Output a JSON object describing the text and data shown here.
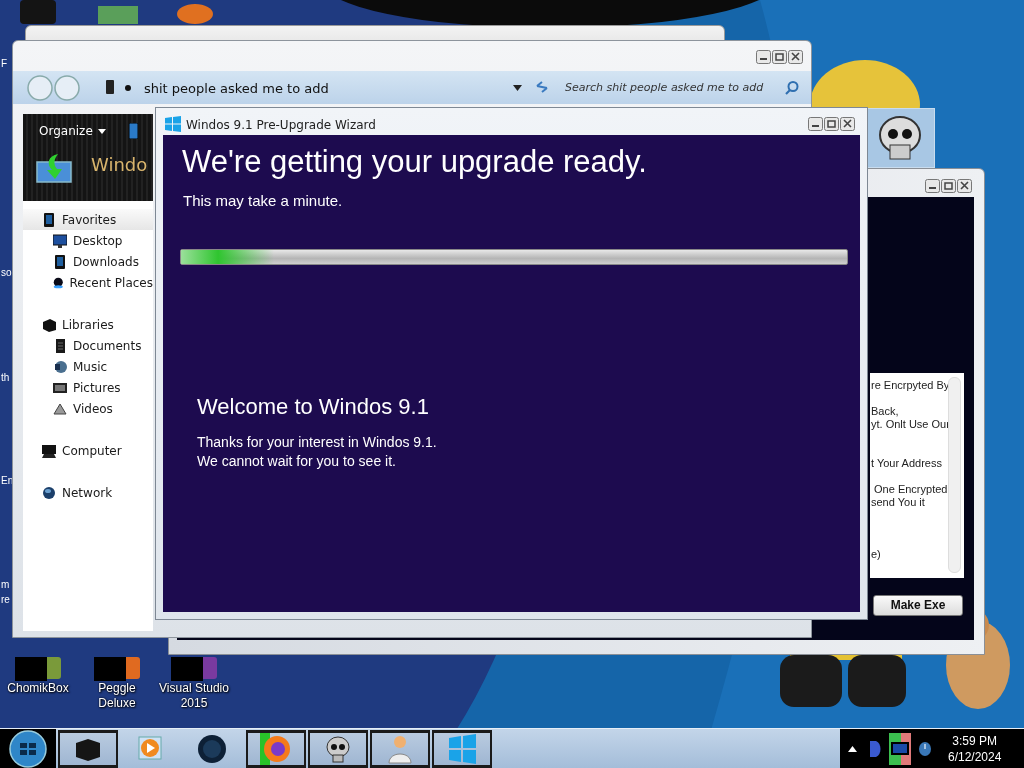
{
  "desktop": {
    "edge_labels": [
      "F",
      "so",
      "th",
      "En",
      "m",
      "re"
    ],
    "icons": [
      {
        "label": "ChomikBox"
      },
      {
        "label": "Peggle Deluxe"
      },
      {
        "label": "Visual Studio 2015"
      }
    ]
  },
  "explorer": {
    "address": "shit people asked me to add",
    "search": {
      "placeholder": "Search shit people asked me to add"
    },
    "organize": "Organize",
    "banner": "Windo",
    "sidebar": [
      {
        "label": "Favorites",
        "selected": true,
        "children": [
          {
            "label": "Desktop",
            "selected": false
          },
          {
            "label": "Downloads",
            "selected": false
          },
          {
            "label": "Recent Places",
            "selected": false
          }
        ]
      },
      {
        "label": "Libraries",
        "selected": false,
        "children": [
          {
            "label": "Documents",
            "selected": false
          },
          {
            "label": "Music",
            "selected": false
          },
          {
            "label": "Pictures",
            "selected": false
          },
          {
            "label": "Videos",
            "selected": false
          }
        ]
      },
      {
        "label": "Computer",
        "selected": false
      },
      {
        "label": "Network",
        "selected": false
      }
    ]
  },
  "wizard": {
    "title": "Windos 9.1 Pre-Upgrade Wizard",
    "heading": "We're getting your upgrade ready.",
    "subheading": "This may take a minute.",
    "progress": {
      "level": 0.14
    },
    "welcome_title": "Welcome to Windos 9.1",
    "welcome_lines": [
      "Thanks for your interest in Windos 9.1.",
      "We cannot wait for you to see it."
    ]
  },
  "builder_window": {
    "paragraphs": [
      [
        "re Encrpyted By"
      ],
      [
        "Back,",
        "yt. Onlt Use Our"
      ],
      [
        "t Your Address"
      ],
      [
        " One Encrypted",
        "send You it"
      ],
      [
        "e)"
      ]
    ],
    "button": "Make Exe"
  },
  "taskbar": {
    "time": "3:59 PM",
    "date": "6/12/2024"
  }
}
